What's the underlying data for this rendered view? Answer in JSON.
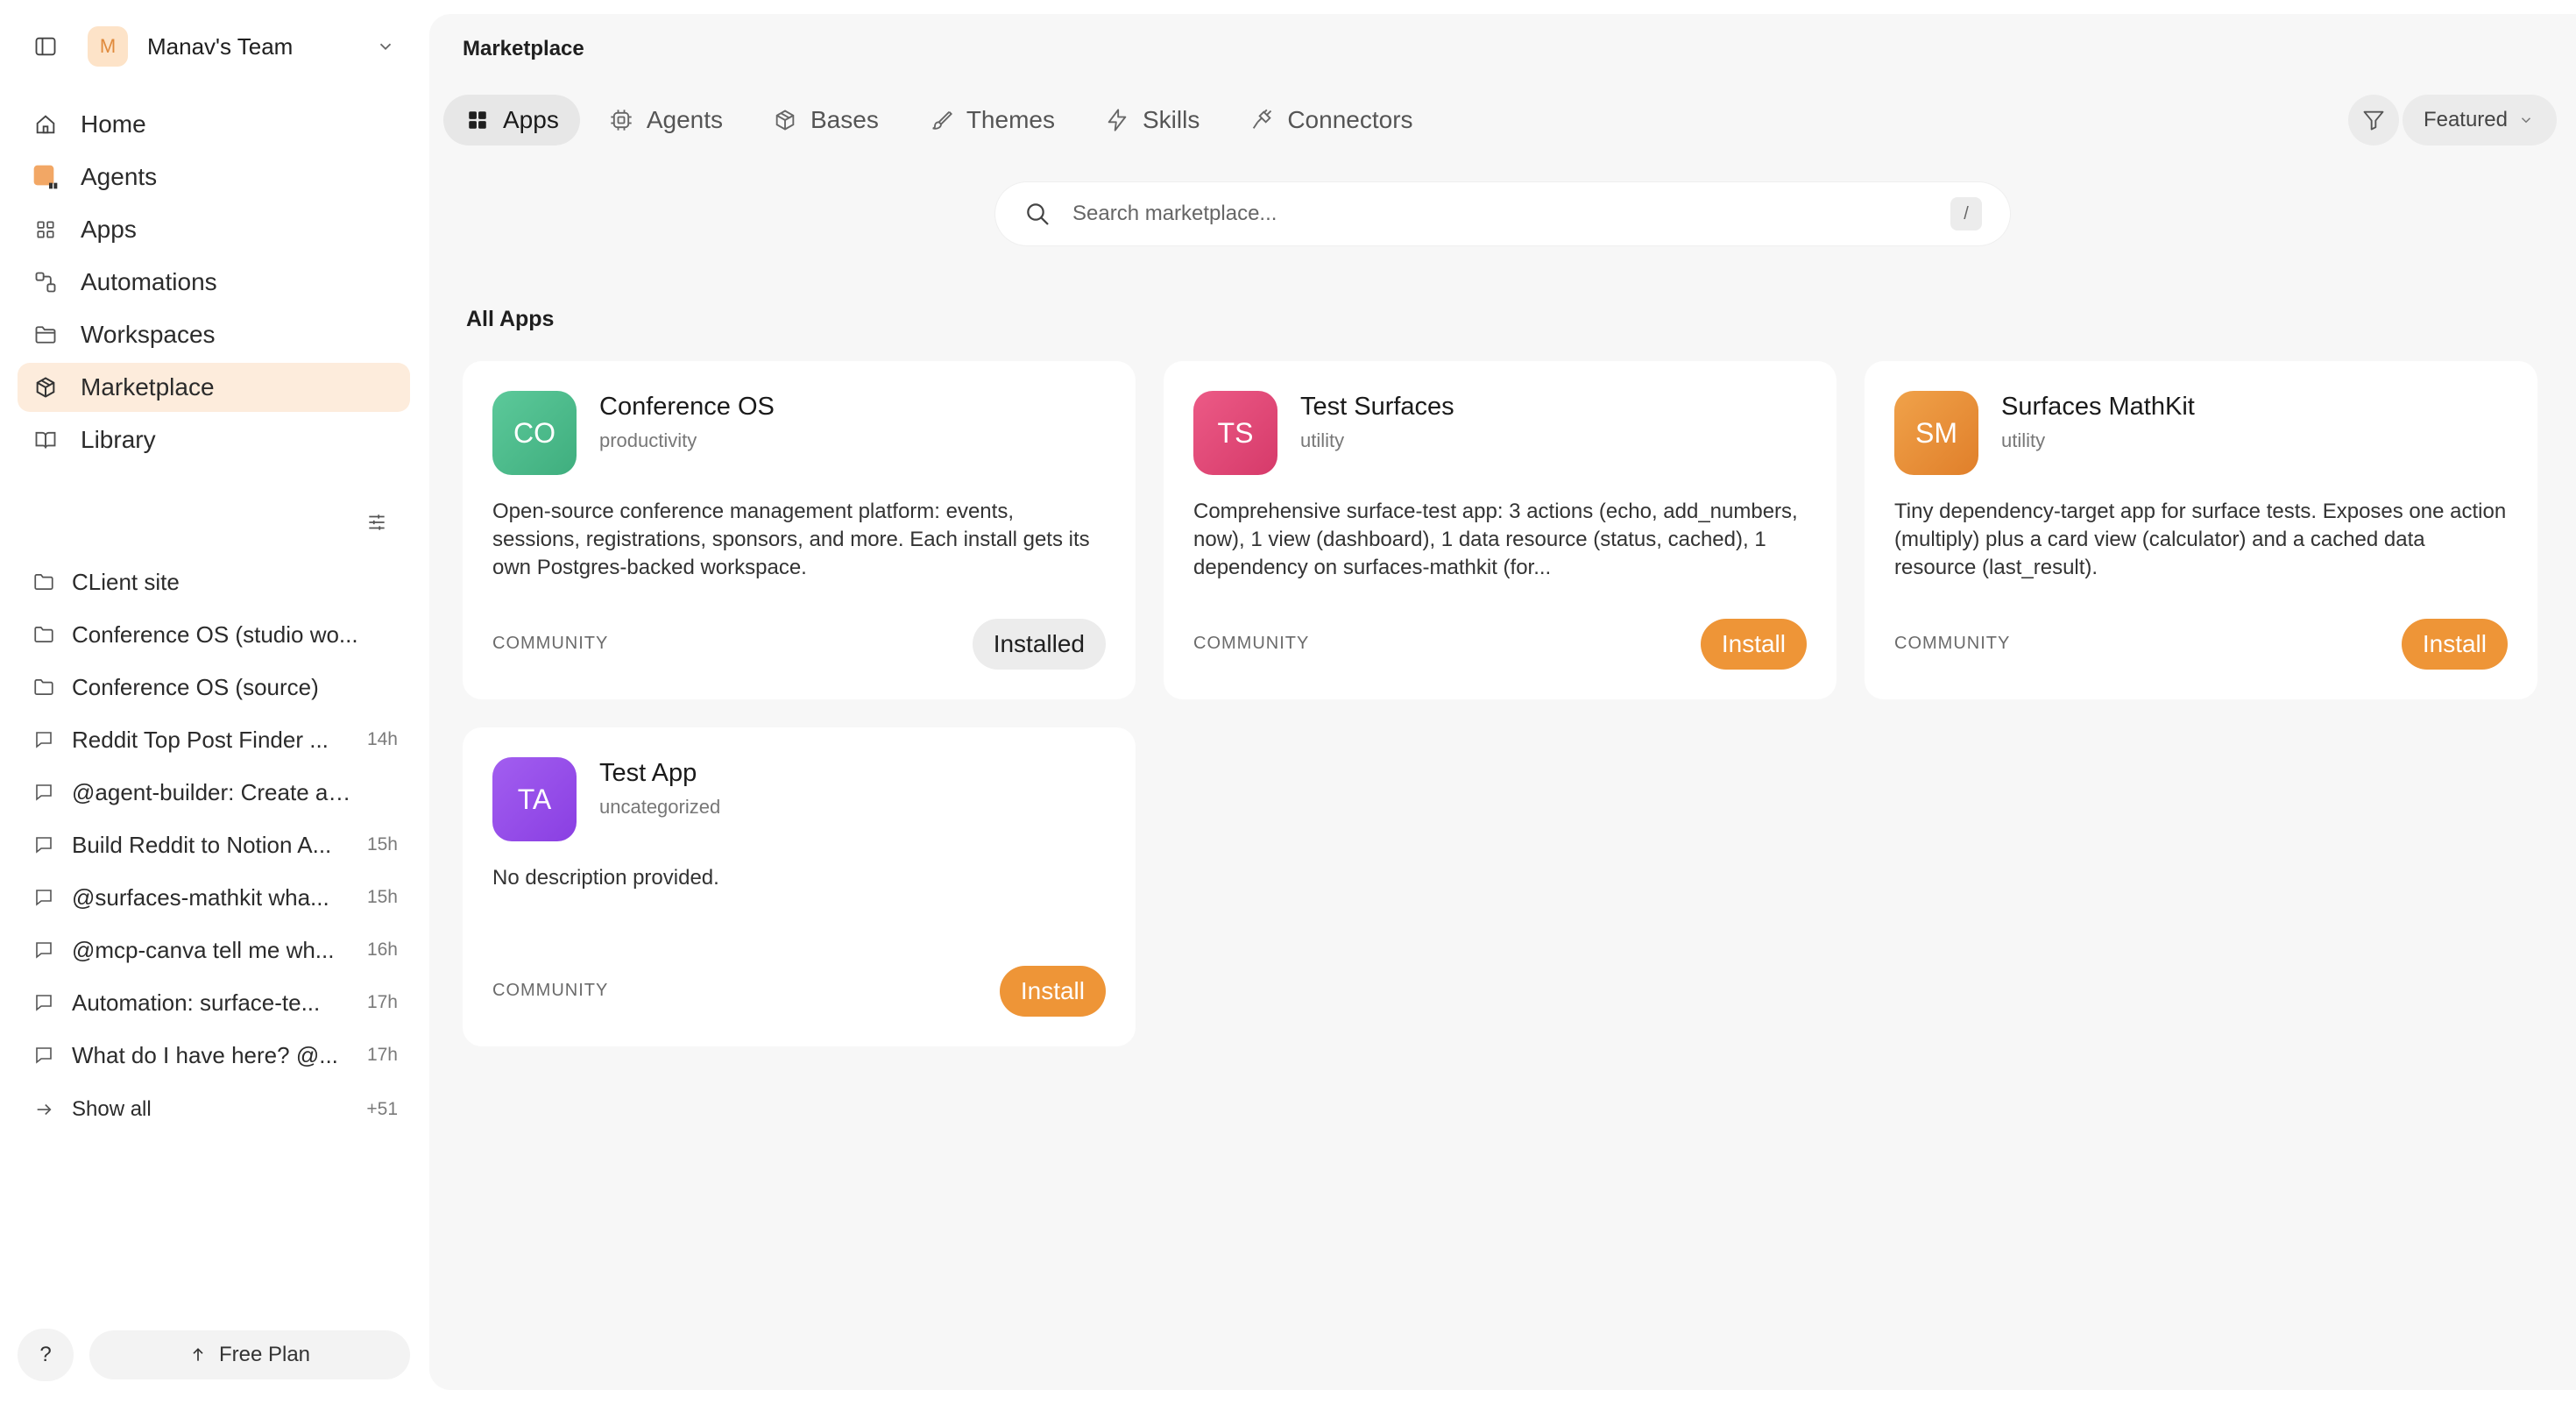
{
  "sidebar": {
    "team": {
      "initial": "M",
      "name": "Manav's Team"
    },
    "nav": [
      {
        "label": "Home",
        "icon": "home-icon"
      },
      {
        "label": "Agents",
        "icon": "agents-icon"
      },
      {
        "label": "Apps",
        "icon": "apps-grid-icon"
      },
      {
        "label": "Automations",
        "icon": "automations-icon"
      },
      {
        "label": "Workspaces",
        "icon": "folder-icon"
      },
      {
        "label": "Marketplace",
        "icon": "cube-icon",
        "active": true
      },
      {
        "label": "Library",
        "icon": "book-icon"
      }
    ],
    "recent": [
      {
        "label": "CLient site",
        "type": "folder",
        "time": ""
      },
      {
        "label": "Conference OS (studio wo...",
        "type": "folder",
        "time": ""
      },
      {
        "label": "Conference OS (source)",
        "type": "folder",
        "time": ""
      },
      {
        "label": "Reddit Top Post Finder ...",
        "type": "chat",
        "time": "14h"
      },
      {
        "label": "@agent-builder: Create a n...",
        "type": "chat",
        "time": ""
      },
      {
        "label": "Build Reddit to Notion A...",
        "type": "chat",
        "time": "15h"
      },
      {
        "label": "@surfaces-mathkit wha...",
        "type": "chat",
        "time": "15h"
      },
      {
        "label": "@mcp-canva tell me wh...",
        "type": "chat",
        "time": "16h"
      },
      {
        "label": "Automation: surface-te...",
        "type": "chat",
        "time": "17h"
      },
      {
        "label": "What do I have here? @...",
        "type": "chat",
        "time": "17h"
      }
    ],
    "show_all": {
      "label": "Show all",
      "count": "+51"
    },
    "help_label": "?",
    "plan_label": "Free Plan"
  },
  "main": {
    "title": "Marketplace",
    "tabs": [
      {
        "label": "Apps",
        "icon": "apps-grid-icon",
        "active": true
      },
      {
        "label": "Agents",
        "icon": "agent-chip-icon"
      },
      {
        "label": "Bases",
        "icon": "box-icon"
      },
      {
        "label": "Themes",
        "icon": "brush-icon"
      },
      {
        "label": "Skills",
        "icon": "bolt-icon"
      },
      {
        "label": "Connectors",
        "icon": "plug-icon"
      }
    ],
    "sort_label": "Featured",
    "search": {
      "placeholder": "Search marketplace...",
      "shortcut": "/"
    },
    "section_title": "All Apps",
    "apps": [
      {
        "initials": "CO",
        "name": "Conference OS",
        "category": "productivity",
        "description": "Open-source conference management platform: events, sessions, registrations, sponsors, and more. Each install gets its own Postgres-backed workspace.",
        "source": "COMMUNITY",
        "action": "Installed",
        "installed": true,
        "gradient": [
          "#5cc99a",
          "#3fae7e"
        ]
      },
      {
        "initials": "TS",
        "name": "Test Surfaces",
        "category": "utility",
        "description": "Comprehensive surface-test app: 3 actions (echo, add_numbers, now), 1 view (dashboard), 1 data resource (status, cached), 1 dependency on surfaces-mathkit (for...",
        "source": "COMMUNITY",
        "action": "Install",
        "installed": false,
        "gradient": [
          "#ec5a86",
          "#d63a6a"
        ]
      },
      {
        "initials": "SM",
        "name": "Surfaces MathKit",
        "category": "utility",
        "description": "Tiny dependency-target app for surface tests. Exposes one action (multiply) plus a card view (calculator) and a cached data resource (last_result).",
        "source": "COMMUNITY",
        "action": "Install",
        "installed": false,
        "gradient": [
          "#f0a24a",
          "#e07f2a"
        ]
      },
      {
        "initials": "TA",
        "name": "Test App",
        "category": "uncategorized",
        "description": "No description provided.",
        "source": "COMMUNITY",
        "action": "Install",
        "installed": false,
        "gradient": [
          "#a25ef0",
          "#8a3fe2"
        ]
      }
    ]
  },
  "colors": {
    "accent": "#ee9537",
    "active_nav_bg": "#fdecdc",
    "main_bg": "#f7f7f7"
  }
}
